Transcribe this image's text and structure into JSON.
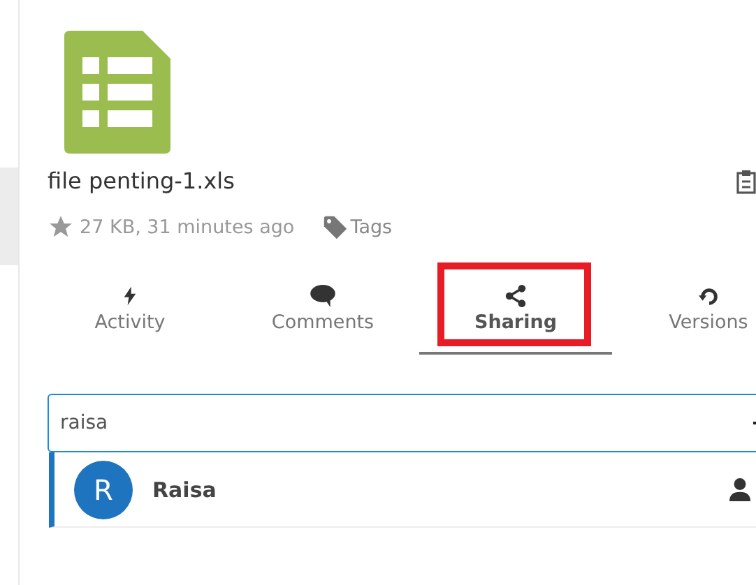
{
  "file": {
    "name": "file penting-1.xls",
    "favorite": false,
    "meta": "27 KB, 31 minutes ago",
    "tags_label": "Tags"
  },
  "tabs": [
    {
      "label": "Activity",
      "kind": "activity",
      "selected": false,
      "annotated": false
    },
    {
      "label": "Comments",
      "kind": "comments",
      "selected": false,
      "annotated": false
    },
    {
      "label": "Sharing",
      "kind": "sharing",
      "selected": true,
      "annotated": true
    },
    {
      "label": "Versions",
      "kind": "versions",
      "selected": false,
      "annotated": false
    }
  ],
  "share_search": {
    "value": "raisa"
  },
  "suggestions": [
    {
      "initial": "R",
      "name": "Raisa",
      "selected": true,
      "color": "#1f74bf"
    }
  ]
}
